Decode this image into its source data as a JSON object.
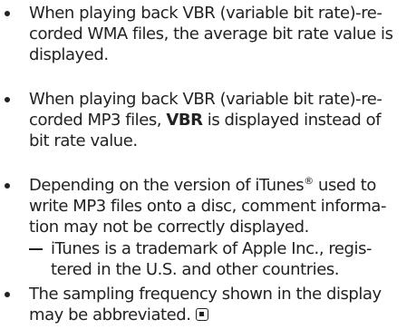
{
  "bullets": [
    {
      "lines": [
        "When playing back VBR (variable bit rate)-re-",
        "corded WMA files, the average bit rate value is",
        "displayed."
      ]
    },
    {
      "lines": [
        "When playing back VBR (variable bit rate)-re-",
        "bit rate value."
      ],
      "line2_before": "corded MP3 files, ",
      "line2_bold": "VBR",
      "line2_after": " is displayed instead of"
    },
    {
      "line1_before": "Depending on the version of iTunes",
      "line1_sup": "®",
      "line1_after": " used to",
      "lines": [
        "write MP3 files onto a disc, comment informa-",
        "tion may not be correctly displayed."
      ],
      "sub_note": [
        "iTunes is a trademark of Apple Inc., regis-",
        "tered in the U.S. and other countries."
      ]
    },
    {
      "lines": [
        "The sampling frequency shown in the display",
        "may be abbreviated."
      ],
      "end_icon": "stop-icon"
    }
  ]
}
